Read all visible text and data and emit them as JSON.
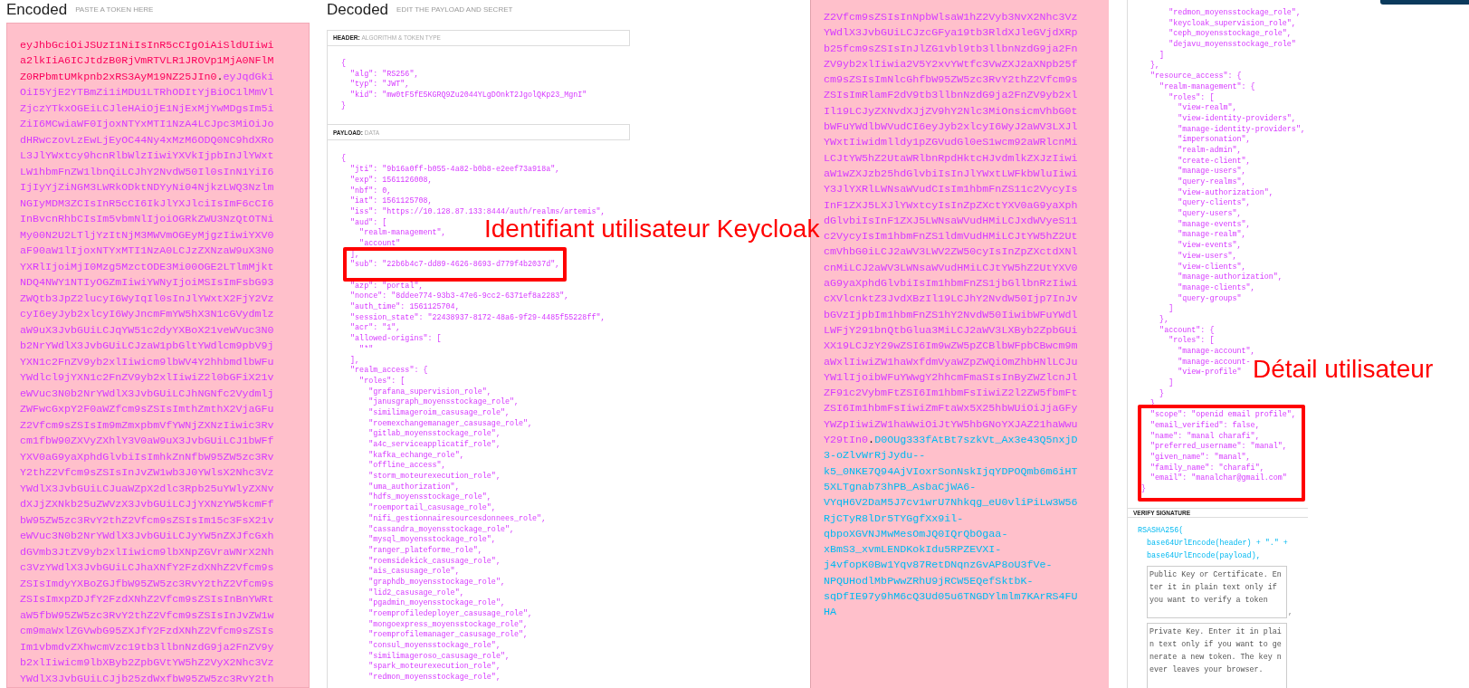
{
  "left_screenshot": {
    "encoded": {
      "title": "Encoded",
      "hint": "PASTE A TOKEN HERE",
      "lines": [
        {
          "kind": "header",
          "text": "eyJhbGciOiJSUzI1NiIsInR5cCIgOiAiSldUIiwi"
        },
        {
          "kind": "header",
          "text": "a2lkIiA6ICJtdzB0RjVmRTVLR1JROVp1MjA0NFlM"
        },
        {
          "segments": [
            {
              "kind": "header",
              "text": "Z0RPbmtUMkpnb2xRS3AyM19NZ25JIn0"
            },
            {
              "kind": "dot",
              "text": "."
            },
            {
              "kind": "payload",
              "text": "eyJqdGki"
            }
          ]
        },
        {
          "kind": "payload",
          "text": "OiI5YjE2YTBmZi1iMDU1LTRhODItYjBiOC1lMmVl"
        },
        {
          "kind": "payload",
          "text": "ZjczYTkxOGEiLCJleHAiOjE1NjExMjYwMDgsIm5i"
        },
        {
          "kind": "payload",
          "text": "ZiI6MCwiaWF0IjoxNTYxMTI1NzA4LCJpc3MiOiJo"
        },
        {
          "kind": "payload",
          "text": "dHRwczovLzEwLjEyOC44Ny4xMzM6ODQ0NC9hdXRo"
        },
        {
          "kind": "payload",
          "text": "L3JlYWxtcy9hcnRlbWlzIiwiYXVkIjpbInJlYWxt"
        },
        {
          "kind": "payload",
          "text": "LW1hbmFnZW1lbnQiLCJhY2NvdW50Il0sInN1YiI6"
        },
        {
          "kind": "payload",
          "text": "IjIyYjZiNGM3LWRkODktNDYyNi04NjkzLWQ3Nzlm"
        },
        {
          "kind": "payload",
          "text": "NGIyMDM3ZCIsInR5cCI6IkJlYXJlciIsImF6cCI6"
        },
        {
          "kind": "payload",
          "text": "InBvcnRhbCIsIm5vbmNlIjoiOGRkZWU3NzQtOTNi"
        },
        {
          "kind": "payload",
          "text": "My00N2U2LTljYzItNjM3MWVmOGEyMjgzIiwiYXV0"
        },
        {
          "kind": "payload",
          "text": "aF90aW1lIjoxNTYxMTI1NzA0LCJzZXNzaW9uX3N0"
        },
        {
          "kind": "payload",
          "text": "YXRlIjoiMjI0Mzg5MzctODE3Mi00OGE2LTlmMjkt"
        },
        {
          "kind": "payload",
          "text": "NDQ4NWY1NTIyOGZmIiwiYWNyIjoiMSIsImFsbG93"
        },
        {
          "kind": "payload",
          "text": "ZWQtb3JpZ2lucyI6WyIqIl0sInJlYWxtX2FjY2Vz"
        },
        {
          "kind": "payload",
          "text": "cyI6eyJyb2xlcyI6WyJncmFmYW5hX3N1cGVydmlz"
        },
        {
          "kind": "payload",
          "text": "aW9uX3JvbGUiLCJqYW51c2dyYXBoX21veWVuc3N0"
        },
        {
          "kind": "payload",
          "text": "b2NrYWdlX3JvbGUiLCJzaW1pbGltYWdlcm9pbV9j"
        },
        {
          "kind": "payload",
          "text": "YXN1c2FnZV9yb2xlIiwicm9lbWV4Y2hhbmdlbWFu"
        },
        {
          "kind": "payload",
          "text": "YWdlcl9jYXN1c2FnZV9yb2xlIiwiZ2l0bGFiX21v"
        },
        {
          "kind": "payload",
          "text": "eWVuc3N0b2NrYWdlX3JvbGUiLCJhNGNfc2Vydmlj"
        },
        {
          "kind": "payload",
          "text": "ZWFwcGxpY2F0aWZfcm9sZSIsImthZmthX2VjaGFu"
        },
        {
          "kind": "payload",
          "text": "Z2Vfcm9sZSIsIm9mZmxpbmVfYWNjZXNzIiwic3Rv"
        },
        {
          "kind": "payload",
          "text": "cm1fbW90ZXVyZXhlY3V0aW9uX3JvbGUiLCJ1bWFf"
        },
        {
          "kind": "payload",
          "text": "YXV0aG9yaXphdGlvbiIsImhkZnNfbW95ZW5zc3Rv"
        },
        {
          "kind": "payload",
          "text": "Y2thZ2Vfcm9sZSIsInJvZW1wb3J0YWlsX2Nhc3Vz"
        },
        {
          "kind": "payload",
          "text": "YWdlX3JvbGUiLCJuaWZpX2dlc3Rpb25uYWlyZXNv"
        },
        {
          "kind": "payload",
          "text": "dXJjZXNkb25uZWVzX3JvbGUiLCJjYXNzYW5kcmFf"
        },
        {
          "kind": "payload",
          "text": "bW95ZW5zc3RvY2thZ2Vfcm9sZSIsIm15c3FsX21v"
        },
        {
          "kind": "payload",
          "text": "eWVuc3N0b2NrYWdlX3JvbGUiLCJyYW5nZXJfcGxh"
        },
        {
          "kind": "payload",
          "text": "dGVmb3JtZV9yb2xlIiwicm9lbXNpZGVraWNrX2Nh"
        },
        {
          "kind": "payload",
          "text": "c3VzYWdlX3JvbGUiLCJhaXNfY2FzdXNhZ2Vfcm9s"
        },
        {
          "kind": "payload",
          "text": "ZSIsImdyYXBoZGJfbW95ZW5zc3RvY2thZ2Vfcm9s"
        },
        {
          "kind": "payload",
          "text": "ZSIsImxpZDJfY2FzdXNhZ2Vfcm9sZSIsInBnYWRt"
        },
        {
          "kind": "payload",
          "text": "aW5fbW95ZW5zc3RvY2thZ2Vfcm9sZSIsInJvZW1w"
        },
        {
          "kind": "payload",
          "text": "cm9maWxlZGVwbG95ZXJfY2FzdXNhZ2Vfcm9sZSIs"
        },
        {
          "kind": "payload",
          "text": "Im1vbmdvZXhwcmVzc19tb3llbnNzdG9ja2FnZV9y"
        },
        {
          "kind": "payload",
          "text": "b2xlIiwicm9lbXByb2ZpbGVtYW5hZ2VyX2Nhc3Vz"
        },
        {
          "kind": "payload",
          "text": "YWdlX3JvbGUiLCJjb25zdWxfbW95ZW5zc3RvY2th"
        }
      ]
    },
    "decoded": {
      "title": "Decoded",
      "hint": "EDIT THE PAYLOAD AND SECRET",
      "header": {
        "label": "HEADER:",
        "sublabel": "ALGORITHM & TOKEN TYPE",
        "lines": [
          "{",
          "  \"alg\": \"RS256\",",
          "  \"typ\": \"JWT\",",
          "  \"kid\": \"mw0tF5fE5KGRQ9Zu2044YLgDOnkT2JgolQKp23_MgnI\"",
          "}"
        ]
      },
      "payload": {
        "label": "PAYLOAD:",
        "sublabel": "DATA",
        "blocks": [
          {
            "boxed": false,
            "lines": [
              "{",
              "  \"jti\": \"9b16a0ff-b055-4a82-b0b8-e2eef73a918a\",",
              "  \"exp\": 1561126008,",
              "  \"nbf\": 0,",
              "  \"iat\": 1561125708,",
              "  \"iss\": \"https://10.128.87.133:8444/auth/realms/artemis\",",
              "  \"aud\": [",
              "    \"realm-management\",",
              "    \"account\""
            ]
          },
          {
            "boxed": true,
            "lines": [
              "  ],",
              "  \"sub\": \"22b6b4c7-dd89-4626-8693-d779f4b2037d\","
            ]
          },
          {
            "boxed": false,
            "lines": [
              "  \"azp\": \"portal\",",
              "  \"nonce\": \"8ddee774-93b3-47e6-9cc2-6371ef8a2283\",",
              "  \"auth_time\": 1561125704,",
              "  \"session_state\": \"22438937-8172-48a6-9f29-4485f55228ff\",",
              "  \"acr\": \"1\",",
              "  \"allowed-origins\": [",
              "    \"*\"",
              "  ],",
              "  \"realm_access\": {",
              "    \"roles\": [",
              "      \"grafana_supervision_role\",",
              "      \"janusgraph_moyensstockage_role\",",
              "      \"similimageroim_casusage_role\",",
              "      \"roemexchangemanager_casusage_role\",",
              "      \"gitlab_moyensstockage_role\",",
              "      \"a4c_serviceapplicatif_role\",",
              "      \"kafka_echange_role\",",
              "      \"offline_access\",",
              "      \"storm_moteurexecution_role\",",
              "      \"uma_authorization\",",
              "      \"hdfs_moyensstockage_role\",",
              "      \"roemportail_casusage_role\",",
              "      \"nifi_gestionnairesourcesdonnees_role\",",
              "      \"cassandra_moyensstockage_role\",",
              "      \"mysql_moyensstockage_role\",",
              "      \"ranger_plateforme_role\",",
              "      \"roemsidekick_casusage_role\",",
              "      \"ais_casusage_role\",",
              "      \"graphdb_moyensstockage_role\",",
              "      \"lid2_casusage_role\",",
              "      \"pgadmin_moyensstockage_role\",",
              "      \"roemprofiledeployer_casusage_role\",",
              "      \"mongoexpress_moyensstockage_role\",",
              "      \"roemprofilemanager_casusage_role\",",
              "      \"consul_moyensstockage_role\",",
              "      \"similimageroso_casusage_role\",",
              "      \"spark_moteurexecution_role\",",
              "      \"redmon_moyensstockage_role\","
            ]
          }
        ]
      }
    }
  },
  "right_screenshot": {
    "encoded": {
      "lines": [
        {
          "kind": "payload",
          "text": "Z2Vfcm9sZSIsInNpbWlsaW1hZ2Vyb3NvX2Nhc3Vz"
        },
        {
          "kind": "payload",
          "text": "YWdlX3JvbGUiLCJzcGFya19tb3RldXJleGVjdXRp"
        },
        {
          "kind": "payload",
          "text": "b25fcm9sZSIsInJlZG1vbl9tb3llbnNzdG9ja2Fn"
        },
        {
          "kind": "payload",
          "text": "ZV9yb2xlIiwia2V5Y2xvYWtfc3VwZXJ2aXNpb25f"
        },
        {
          "kind": "payload",
          "text": "cm9sZSIsImNlcGhfbW95ZW5zc3RvY2thZ2Vfcm9s"
        },
        {
          "kind": "payload",
          "text": "ZSIsImRlamF2dV9tb3llbnNzdG9ja2FnZV9yb2xl"
        },
        {
          "kind": "payload",
          "text": "Il19LCJyZXNvdXJjZV9hY2Nlc3MiOnsicmVhbG0t"
        },
        {
          "kind": "payload",
          "text": "bWFuYWdlbWVudCI6eyJyb2xlcyI6WyJ2aWV3LXJl"
        },
        {
          "kind": "payload",
          "text": "YWxtIiwidmlldy1pZGVudGl0eS1wcm92aWRlcnMi"
        },
        {
          "kind": "payload",
          "text": "LCJtYW5hZ2UtaWRlbnRpdHktcHJvdmlkZXJzIiwi"
        },
        {
          "kind": "payload",
          "text": "aW1wZXJzb25hdGlvbiIsInJlYWxtLWFkbWluIiwi"
        },
        {
          "kind": "payload",
          "text": "Y3JlYXRlLWNsaWVudCIsIm1hbmFnZS11c2VycyIs"
        },
        {
          "kind": "payload",
          "text": "InF1ZXJ5LXJlYWxtcyIsInZpZXctYXV0aG9yaXph"
        },
        {
          "kind": "payload",
          "text": "dGlvbiIsInF1ZXJ5LWNsaWVudHMiLCJxdWVyeS11"
        },
        {
          "kind": "payload",
          "text": "c2VycyIsIm1hbmFnZS1ldmVudHMiLCJtYW5hZ2Ut"
        },
        {
          "kind": "payload",
          "text": "cmVhbG0iLCJ2aWV3LWV2ZW50cyIsInZpZXctdXNl"
        },
        {
          "kind": "payload",
          "text": "cnMiLCJ2aWV3LWNsaWVudHMiLCJtYW5hZ2UtYXV0"
        },
        {
          "kind": "payload",
          "text": "aG9yaXphdGlvbiIsIm1hbmFnZS1jbGllbnRzIiwi"
        },
        {
          "kind": "payload",
          "text": "cXVlcnktZ3JvdXBzIl19LCJhY2NvdW50Ijp7InJv"
        },
        {
          "kind": "payload",
          "text": "bGVzIjpbIm1hbmFnZS1hY2NvdW50IiwibWFuYWdl"
        },
        {
          "kind": "payload",
          "text": "LWFjY291bnQtbGlua3MiLCJ2aWV3LXByb2ZpbGUi"
        },
        {
          "kind": "payload",
          "text": "XX19LCJzY29wZSI6Im9wZW5pZCBlbWFpbCBwcm9m"
        },
        {
          "kind": "payload",
          "text": "aWxlIiwiZW1haWxfdmVyaWZpZWQiOmZhbHNlLCJu"
        },
        {
          "kind": "payload",
          "text": "YW1lIjoibWFuYWwgY2hhcmFmaSIsInByZWZlcnJl"
        },
        {
          "kind": "payload",
          "text": "ZF91c2VybmFtZSI6Im1hbmFsIiwiZ2l2ZW5fbmFt"
        },
        {
          "kind": "payload",
          "text": "ZSI6Im1hbmFsIiwiZmFtaWx5X25hbWUiOiJjaGFy"
        },
        {
          "kind": "payload",
          "text": "YWZpIiwiZW1haWwiOiJtYW5hbGNoYXJAZ21haWwu"
        },
        {
          "segments": [
            {
              "kind": "payload",
              "text": "Y29tIn0"
            },
            {
              "kind": "dot",
              "text": "."
            },
            {
              "kind": "signature",
              "text": "D0OUg333fAtBt7szkVt_Ax3e43Q5nxjD"
            }
          ]
        },
        {
          "kind": "signature",
          "text": "3-oZlvWrRjJydu--"
        },
        {
          "kind": "signature",
          "text": "k5_0NKE7Q94AjVIoxrSonNskIjqYDPOQmb6m6iHT"
        },
        {
          "kind": "signature",
          "text": "5XLTgnab73hPB_AsbaCjWA6-"
        },
        {
          "kind": "signature",
          "text": "VYqH6V2DaM5J7cv1wrU7Nhkqg_eU0vliPiLw3W56"
        },
        {
          "kind": "signature",
          "text": "RjCTyR8lDr5TYGgfXx9il-"
        },
        {
          "kind": "signature",
          "text": "qbpoXGVNJMwMesOmJQ0IQrQbOgaa-"
        },
        {
          "kind": "signature",
          "text": "xBmS3_xvmLENDKokIdu5RPZEVXI-"
        },
        {
          "kind": "signature",
          "text": "j4vfopK0Bw1Yqv87RetDNqnzGvAP8oU3fVe-"
        },
        {
          "kind": "signature",
          "text": "NPQUHodlMbPwwZRhU9jRCW5EQefSktbK-"
        },
        {
          "kind": "signature",
          "text": "sqDfIE97y9hM6cQ3Ud05u6TNGDYlmlm7KArRS4FU"
        },
        {
          "kind": "signature",
          "text": "HA"
        }
      ]
    },
    "decoded": {
      "payload_blocks": [
        {
          "boxed": false,
          "lines": [
            "      \"redmon_moyensstockage_role\",",
            "      \"keycloak_supervision_role\",",
            "      \"ceph_moyensstockage_role\",",
            "      \"dejavu_moyensstockage_role\"",
            "    ]",
            "  },",
            "  \"resource_access\": {",
            "    \"realm-management\": {",
            "      \"roles\": [",
            "        \"view-realm\",",
            "        \"view-identity-providers\",",
            "        \"manage-identity-providers\",",
            "        \"impersonation\",",
            "        \"realm-admin\",",
            "        \"create-client\",",
            "        \"manage-users\",",
            "        \"query-realms\",",
            "        \"view-authorization\",",
            "        \"query-clients\",",
            "        \"query-users\",",
            "        \"manage-events\",",
            "        \"manage-realm\",",
            "        \"view-events\",",
            "        \"view-users\",",
            "        \"view-clients\",",
            "        \"manage-authorization\",",
            "        \"manage-clients\",",
            "        \"query-groups\"",
            "      ]",
            "    },",
            "    \"account\": {",
            "      \"roles\": [",
            "        \"manage-account\",",
            "        \"manage-account-",
            "        \"view-profile\"",
            "      ]",
            "    }",
            "  },"
          ]
        },
        {
          "boxed": true,
          "lines": [
            "  \"scope\": \"openid email profile\",",
            "  \"email_verified\": false,",
            "  \"name\": \"manal charafi\",",
            "  \"preferred_username\": \"manal\",",
            "  \"given_name\": \"manal\",",
            "  \"family_name\": \"charafi\",",
            "  \"email\": \"manalchar@gmail.com\"",
            "}"
          ]
        }
      ],
      "verify_signature": {
        "label": "VERIFY SIGNATURE",
        "lines": [
          "RSASHA256(",
          "  base64UrlEncode(header) + \".\" +",
          "  base64UrlEncode(payload),"
        ],
        "public_key": {
          "placeholder": "Public Key or Certificate. Enter it in plain text only if you want to verify a token"
        },
        "separator": ",",
        "private_key": {
          "placeholder": "Private Key. Enter it in plain text only if you want to generate a new token. The key never leaves your browser."
        }
      }
    }
  },
  "annotations": [
    {
      "text": "Identifiant utilisateur Keycloak"
    },
    {
      "text": "Détail utilisateur"
    }
  ]
}
